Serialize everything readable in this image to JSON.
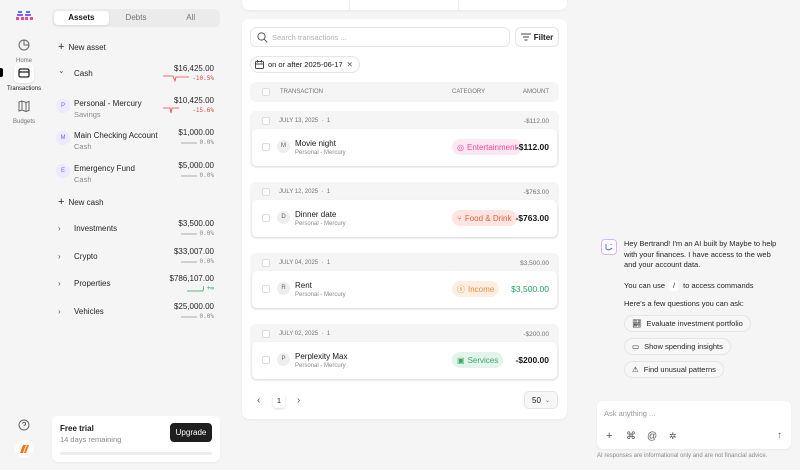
{
  "nav": {
    "items": [
      {
        "label": "Home"
      },
      {
        "label": "Transactions"
      },
      {
        "label": "Budgets"
      }
    ]
  },
  "accounts": {
    "tabs": [
      "Assets",
      "Debts",
      "All"
    ],
    "new_asset": "New asset",
    "groups": [
      {
        "name": "Cash",
        "value": "$16,425.00",
        "change": "-10.5%",
        "trend": "down",
        "expanded": true
      },
      {
        "name": "Investments",
        "value": "$3,500.00",
        "change": "0.0%",
        "trend": "flat"
      },
      {
        "name": "Crypto",
        "value": "$33,007.00",
        "change": "0.0%",
        "trend": "flat"
      },
      {
        "name": "Properties",
        "value": "$786,107.00",
        "change": "+∞",
        "trend": "up"
      },
      {
        "name": "Vehicles",
        "value": "$25,000.00",
        "change": "0.0%",
        "trend": "flat"
      }
    ],
    "cash_accounts": [
      {
        "initial": "P",
        "name": "Personal - Mercury",
        "type": "Savings",
        "value": "$10,425.00",
        "change": "-15.6%",
        "trend": "down"
      },
      {
        "initial": "M",
        "name": "Main Checking Account",
        "type": "Cash",
        "value": "$1,000.00",
        "change": "0.0%",
        "trend": "flat"
      },
      {
        "initial": "E",
        "name": "Emergency Fund",
        "type": "Cash",
        "value": "$5,000.00",
        "change": "0.0%",
        "trend": "flat"
      }
    ],
    "new_cash": "New cash"
  },
  "trial": {
    "title": "Free trial",
    "remaining": "14 days remaining",
    "upgrade": "Upgrade",
    "progress": 0
  },
  "transactions": {
    "search_placeholder": "Search transactions ...",
    "filter": "Filter",
    "date_chip": "on or after 2025-06-17",
    "headers": {
      "transaction": "TRANSACTION",
      "category": "CATEGORY",
      "amount": "AMOUNT"
    },
    "groups": [
      {
        "date": "JULY 13, 2025",
        "count": "1",
        "total": "-$112.00",
        "item": {
          "initial": "M",
          "name": "Movie night",
          "account": "Personal - Mercury",
          "category": "Entertainment",
          "amount": "-$112.00"
        }
      },
      {
        "date": "JULY 12, 2025",
        "count": "1",
        "total": "-$763.00",
        "item": {
          "initial": "D",
          "name": "Dinner date",
          "account": "Personal - Mercury",
          "category": "Food & Drink",
          "amount": "-$763.00"
        }
      },
      {
        "date": "JULY 04, 2025",
        "count": "1",
        "total": "$3,500.00",
        "item": {
          "initial": "R",
          "name": "Rent",
          "account": "Personal - Mercury",
          "category": "Income",
          "amount": "$3,500.00"
        }
      },
      {
        "date": "JULY 02, 2025",
        "count": "1",
        "total": "-$200.00",
        "item": {
          "initial": "P",
          "name": "Perplexity Max",
          "account": "Personal - Mercury",
          "category": "Services",
          "amount": "-$200.00"
        }
      }
    ],
    "page": "1",
    "per_page": "50"
  },
  "chat": {
    "greeting": "Hey Bertrand! I'm an AI built by Maybe to help with your finances. I have access to the web and your account data.",
    "commands_pre": "You can use",
    "commands_key": "/",
    "commands_post": "to access commands",
    "questions_intro": "Here's a few questions you can ask:",
    "suggestions": [
      "Evaluate investment portfolio",
      "Show spending insights",
      "Find unusual patterns"
    ],
    "input_placeholder": "Ask anything ...",
    "disclaimer": "AI responses are informational only and are not financial advice."
  },
  "colors": {
    "negative": "#ef4444",
    "positive": "#22a55b",
    "entertainment": "#ec4899",
    "food": "#f05a3c",
    "income": "#f08a3c",
    "services": "#3aa76d"
  }
}
